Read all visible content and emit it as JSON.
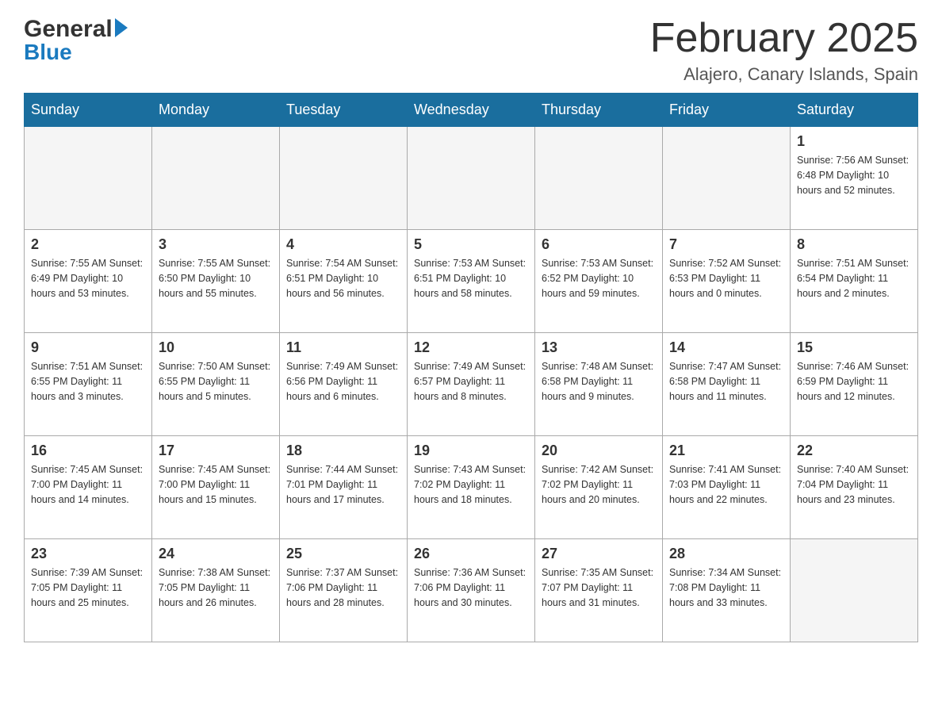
{
  "header": {
    "logo_general": "General",
    "logo_blue": "Blue",
    "month_title": "February 2025",
    "location": "Alajero, Canary Islands, Spain"
  },
  "days_of_week": [
    "Sunday",
    "Monday",
    "Tuesday",
    "Wednesday",
    "Thursday",
    "Friday",
    "Saturday"
  ],
  "weeks": [
    [
      {
        "day": "",
        "info": "",
        "empty": true
      },
      {
        "day": "",
        "info": "",
        "empty": true
      },
      {
        "day": "",
        "info": "",
        "empty": true
      },
      {
        "day": "",
        "info": "",
        "empty": true
      },
      {
        "day": "",
        "info": "",
        "empty": true
      },
      {
        "day": "",
        "info": "",
        "empty": true
      },
      {
        "day": "1",
        "info": "Sunrise: 7:56 AM\nSunset: 6:48 PM\nDaylight: 10 hours\nand 52 minutes.",
        "empty": false
      }
    ],
    [
      {
        "day": "2",
        "info": "Sunrise: 7:55 AM\nSunset: 6:49 PM\nDaylight: 10 hours\nand 53 minutes.",
        "empty": false
      },
      {
        "day": "3",
        "info": "Sunrise: 7:55 AM\nSunset: 6:50 PM\nDaylight: 10 hours\nand 55 minutes.",
        "empty": false
      },
      {
        "day": "4",
        "info": "Sunrise: 7:54 AM\nSunset: 6:51 PM\nDaylight: 10 hours\nand 56 minutes.",
        "empty": false
      },
      {
        "day": "5",
        "info": "Sunrise: 7:53 AM\nSunset: 6:51 PM\nDaylight: 10 hours\nand 58 minutes.",
        "empty": false
      },
      {
        "day": "6",
        "info": "Sunrise: 7:53 AM\nSunset: 6:52 PM\nDaylight: 10 hours\nand 59 minutes.",
        "empty": false
      },
      {
        "day": "7",
        "info": "Sunrise: 7:52 AM\nSunset: 6:53 PM\nDaylight: 11 hours\nand 0 minutes.",
        "empty": false
      },
      {
        "day": "8",
        "info": "Sunrise: 7:51 AM\nSunset: 6:54 PM\nDaylight: 11 hours\nand 2 minutes.",
        "empty": false
      }
    ],
    [
      {
        "day": "9",
        "info": "Sunrise: 7:51 AM\nSunset: 6:55 PM\nDaylight: 11 hours\nand 3 minutes.",
        "empty": false
      },
      {
        "day": "10",
        "info": "Sunrise: 7:50 AM\nSunset: 6:55 PM\nDaylight: 11 hours\nand 5 minutes.",
        "empty": false
      },
      {
        "day": "11",
        "info": "Sunrise: 7:49 AM\nSunset: 6:56 PM\nDaylight: 11 hours\nand 6 minutes.",
        "empty": false
      },
      {
        "day": "12",
        "info": "Sunrise: 7:49 AM\nSunset: 6:57 PM\nDaylight: 11 hours\nand 8 minutes.",
        "empty": false
      },
      {
        "day": "13",
        "info": "Sunrise: 7:48 AM\nSunset: 6:58 PM\nDaylight: 11 hours\nand 9 minutes.",
        "empty": false
      },
      {
        "day": "14",
        "info": "Sunrise: 7:47 AM\nSunset: 6:58 PM\nDaylight: 11 hours\nand 11 minutes.",
        "empty": false
      },
      {
        "day": "15",
        "info": "Sunrise: 7:46 AM\nSunset: 6:59 PM\nDaylight: 11 hours\nand 12 minutes.",
        "empty": false
      }
    ],
    [
      {
        "day": "16",
        "info": "Sunrise: 7:45 AM\nSunset: 7:00 PM\nDaylight: 11 hours\nand 14 minutes.",
        "empty": false
      },
      {
        "day": "17",
        "info": "Sunrise: 7:45 AM\nSunset: 7:00 PM\nDaylight: 11 hours\nand 15 minutes.",
        "empty": false
      },
      {
        "day": "18",
        "info": "Sunrise: 7:44 AM\nSunset: 7:01 PM\nDaylight: 11 hours\nand 17 minutes.",
        "empty": false
      },
      {
        "day": "19",
        "info": "Sunrise: 7:43 AM\nSunset: 7:02 PM\nDaylight: 11 hours\nand 18 minutes.",
        "empty": false
      },
      {
        "day": "20",
        "info": "Sunrise: 7:42 AM\nSunset: 7:02 PM\nDaylight: 11 hours\nand 20 minutes.",
        "empty": false
      },
      {
        "day": "21",
        "info": "Sunrise: 7:41 AM\nSunset: 7:03 PM\nDaylight: 11 hours\nand 22 minutes.",
        "empty": false
      },
      {
        "day": "22",
        "info": "Sunrise: 7:40 AM\nSunset: 7:04 PM\nDaylight: 11 hours\nand 23 minutes.",
        "empty": false
      }
    ],
    [
      {
        "day": "23",
        "info": "Sunrise: 7:39 AM\nSunset: 7:05 PM\nDaylight: 11 hours\nand 25 minutes.",
        "empty": false
      },
      {
        "day": "24",
        "info": "Sunrise: 7:38 AM\nSunset: 7:05 PM\nDaylight: 11 hours\nand 26 minutes.",
        "empty": false
      },
      {
        "day": "25",
        "info": "Sunrise: 7:37 AM\nSunset: 7:06 PM\nDaylight: 11 hours\nand 28 minutes.",
        "empty": false
      },
      {
        "day": "26",
        "info": "Sunrise: 7:36 AM\nSunset: 7:06 PM\nDaylight: 11 hours\nand 30 minutes.",
        "empty": false
      },
      {
        "day": "27",
        "info": "Sunrise: 7:35 AM\nSunset: 7:07 PM\nDaylight: 11 hours\nand 31 minutes.",
        "empty": false
      },
      {
        "day": "28",
        "info": "Sunrise: 7:34 AM\nSunset: 7:08 PM\nDaylight: 11 hours\nand 33 minutes.",
        "empty": false
      },
      {
        "day": "",
        "info": "",
        "empty": true
      }
    ]
  ]
}
